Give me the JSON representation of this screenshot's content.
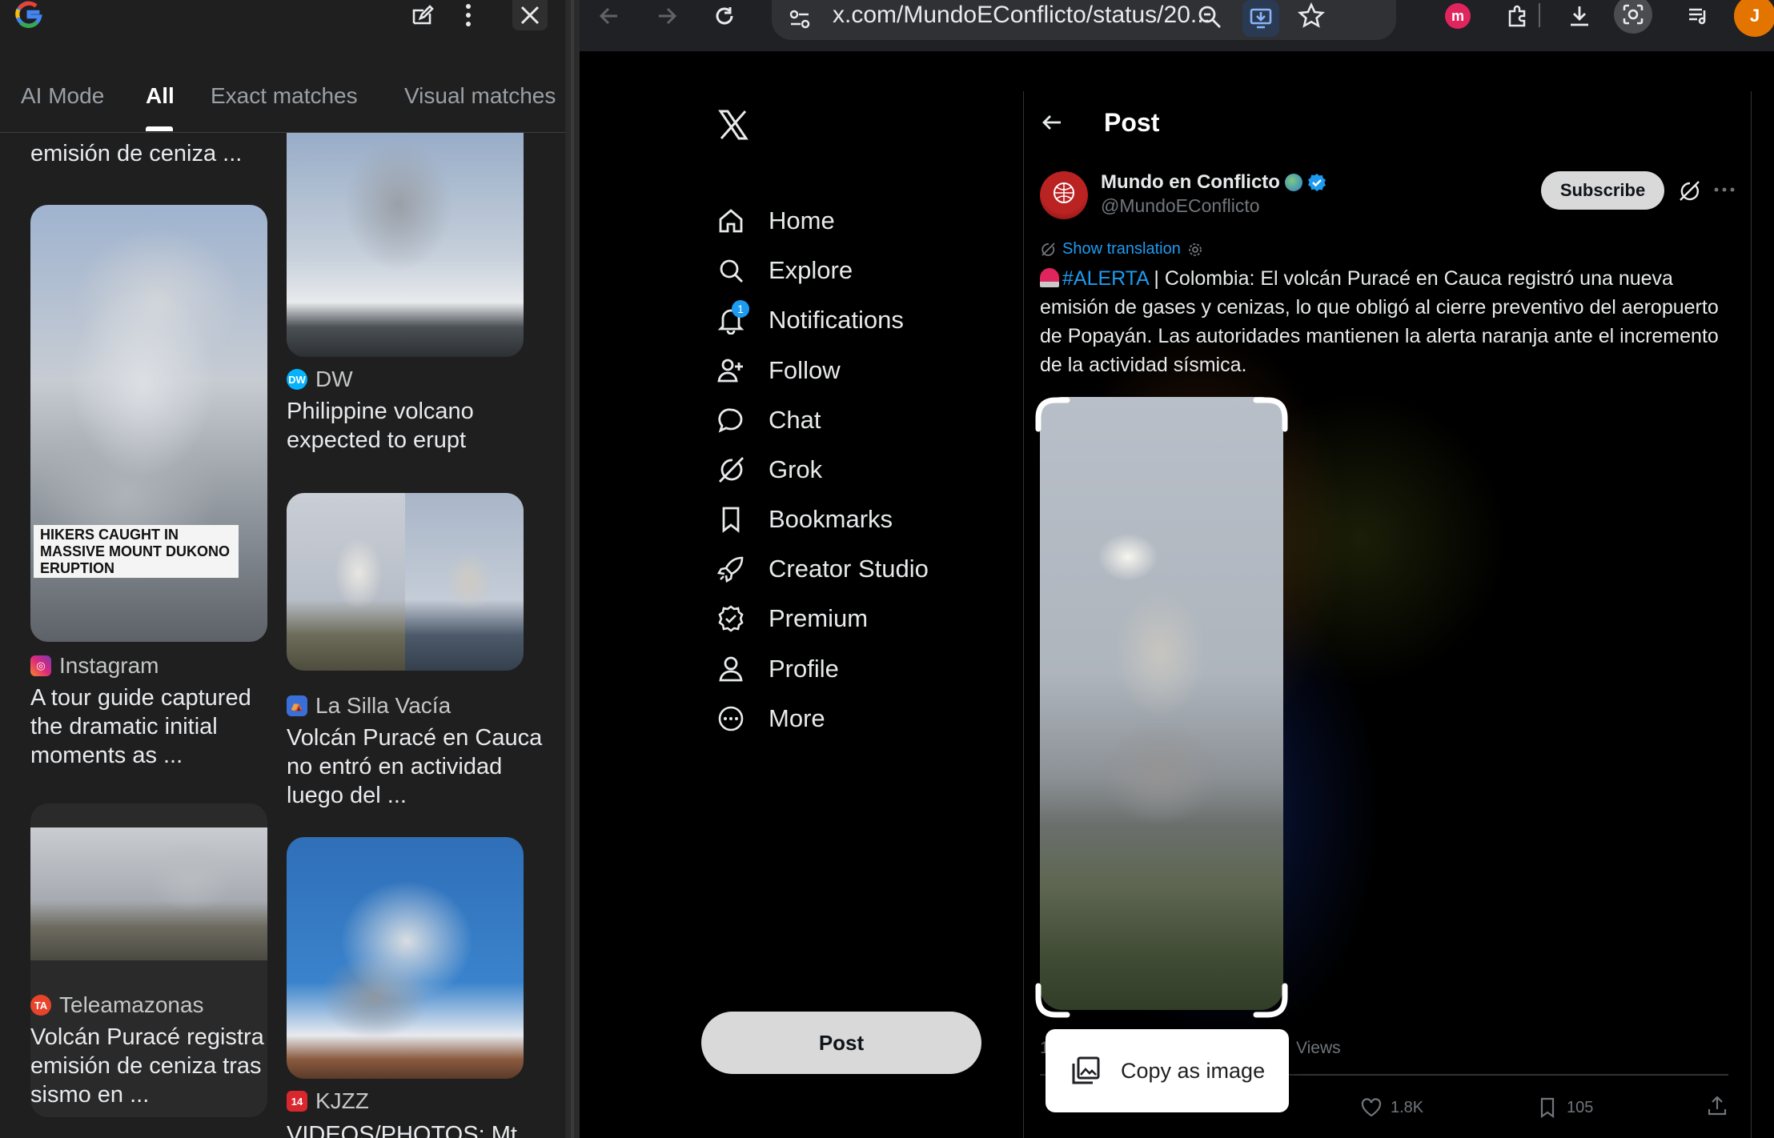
{
  "lens": {
    "tabs": [
      "AI Mode",
      "All",
      "Exact matches",
      "Visual matches"
    ],
    "results": [
      {
        "title": "emisión de ceniza ..."
      },
      {
        "source": "Instagram",
        "title": "A tour guide captured the dramatic initial moments as ...",
        "overlay": "HIKERS CAUGHT IN MASSIVE MOUNT DUKONO ERUPTION"
      },
      {
        "source": "Teleamazonas",
        "title": "Volcán Puracé registra emisión de ceniza tras sismo en ..."
      },
      {
        "source": "DW",
        "title": "Philippine volcano expected to erupt"
      },
      {
        "source": "La Silla Vacía",
        "title": "Volcán Puracé en Cauca no entró en actividad luego del ..."
      },
      {
        "source": "KJZZ",
        "title": "VIDEOS/PHOTOS: Mt ..."
      }
    ]
  },
  "browser": {
    "url": "x.com/MundoEConflicto/status/20..."
  },
  "x": {
    "nav": [
      "Home",
      "Explore",
      "Notifications",
      "Follow",
      "Chat",
      "Grok",
      "Bookmarks",
      "Creator Studio",
      "Premium",
      "Profile",
      "More"
    ],
    "notif_badge": "1",
    "post_button": "Post",
    "header": "Post",
    "author_name": "Mundo en Conflicto",
    "author_handle": "@MundoEConflicto",
    "subscribe": "Subscribe",
    "show_translation": "Show translation",
    "hashtag": "#ALERTA",
    "text": " | Colombia: El volcán Puracé en Cauca registró una nueva emisión de gases y cenizas, lo que obligó al cierre preventivo del aeropuerto de Popayán. Las autoridades mantienen la alerta naranja ante el incremento de la actividad sísmica.",
    "views_fragment": "1",
    "views_label": "Views",
    "likes": "1.8K",
    "bookmarks": "105",
    "copy_as_image": "Copy as image"
  }
}
